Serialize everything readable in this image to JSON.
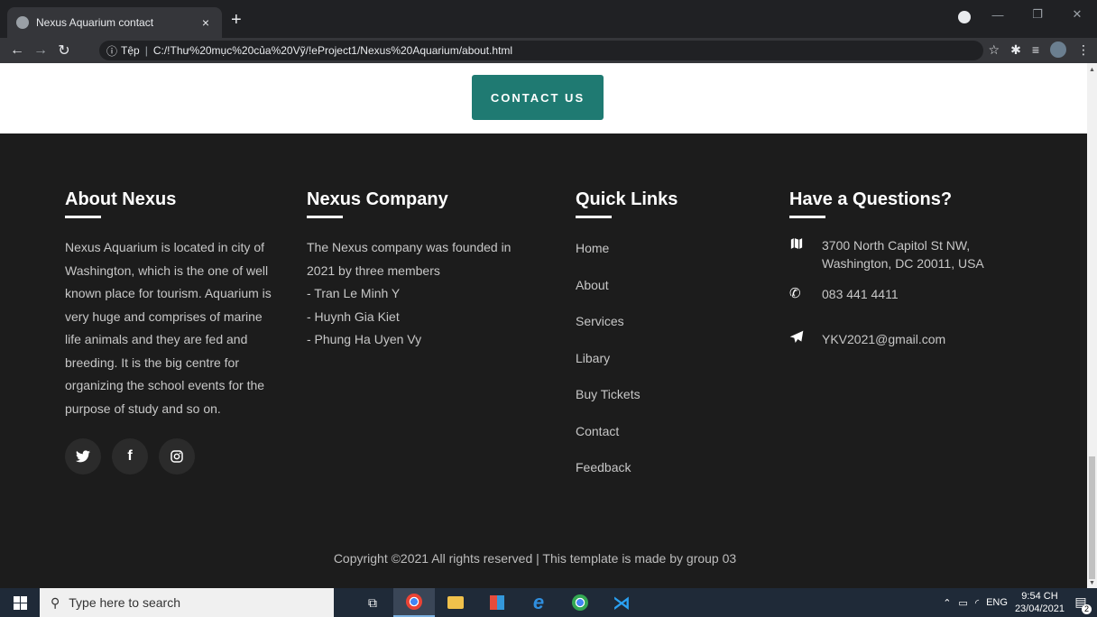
{
  "browser": {
    "tab_title": "Nexus Aquarium contact",
    "tab_close": "×",
    "new_tab": "+",
    "scheme_label": "Tệp",
    "url": "C:/!Thư%20mục%20của%20Vỹ/!eProject1/Nexus%20Aquarium/about.html"
  },
  "page": {
    "cta_label": "CONTACT US"
  },
  "footer": {
    "about": {
      "title": "About Nexus",
      "text": "Nexus Aquarium is located in city of Washington, which is the one of well known place for tourism. Aquarium is very huge and comprises of marine life animals and they are fed and breeding. It is the big centre for organizing the school events for the purpose of study and so on."
    },
    "company": {
      "title": "Nexus Company",
      "lines": [
        "The Nexus company was founded in",
        "2021 by three members",
        "- Tran Le Minh Y",
        "- Huynh Gia Kiet",
        "- Phung Ha Uyen Vy"
      ]
    },
    "links": {
      "title": "Quick Links",
      "items": [
        "Home",
        "About",
        "Services",
        "Libary",
        "Buy Tickets",
        "Contact",
        "Feedback"
      ]
    },
    "contact": {
      "title": "Have a Questions?",
      "address_line1": "3700 North Capitol St NW,",
      "address_line2": "Washington, DC 20011, USA",
      "phone": "083 441 4411",
      "email": "YKV2021@gmail.com"
    },
    "copyright": "Copyright ©2021 All rights reserved | This template is made by group 03"
  },
  "taskbar": {
    "search_placeholder": "Type here to search",
    "tray_lang": "ENG",
    "time": "9:54 CH",
    "date": "23/04/2021",
    "notification_count": "2"
  }
}
